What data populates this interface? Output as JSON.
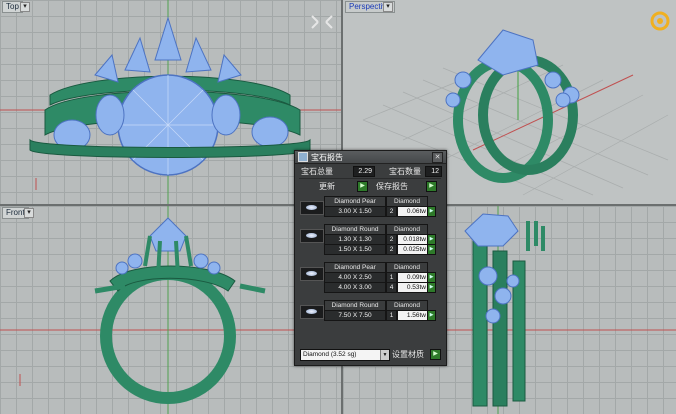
{
  "viewports": {
    "top": {
      "label": "Top"
    },
    "perspective": {
      "label": "Perspective"
    },
    "front": {
      "label": "Front"
    }
  },
  "dialog": {
    "title": "宝石报告",
    "total_weight_label": "宝石总量",
    "total_weight_value": "2.29",
    "count_label": "宝石数量",
    "count_value": "12",
    "update_label": "更新",
    "save_report_label": "保存报告",
    "gems": [
      {
        "name": "Diamond Pear",
        "material": "Diamond",
        "rows": [
          {
            "size": "3.00 X 1.50",
            "qty": "2",
            "tw": "0.06tw"
          }
        ]
      },
      {
        "name": "Diamond Round",
        "material": "Diamond",
        "rows": [
          {
            "size": "1.30 X 1.30",
            "qty": "2",
            "tw": "0.018tw"
          },
          {
            "size": "1.50 X 1.50",
            "qty": "2",
            "tw": "0.025tw"
          }
        ]
      },
      {
        "name": "Diamond Pear",
        "material": "Diamond",
        "rows": [
          {
            "size": "4.00 X 2.50",
            "qty": "1",
            "tw": "0.09tw"
          },
          {
            "size": "4.00 X 3.00",
            "qty": "4",
            "tw": "0.53tw"
          }
        ]
      },
      {
        "name": "Diamond Round",
        "material": "Diamond",
        "rows": [
          {
            "size": "7.50 X 7.50",
            "qty": "1",
            "tw": "1.56tw"
          }
        ]
      }
    ],
    "material_select": "Diamond   (3.52 sg)",
    "set_material_label": "设置材质"
  },
  "colors": {
    "metal": "#2e8a66",
    "gem": "#8fb4ee",
    "panel": "#3b3d3e",
    "accent_green": "#2e7a2a"
  }
}
